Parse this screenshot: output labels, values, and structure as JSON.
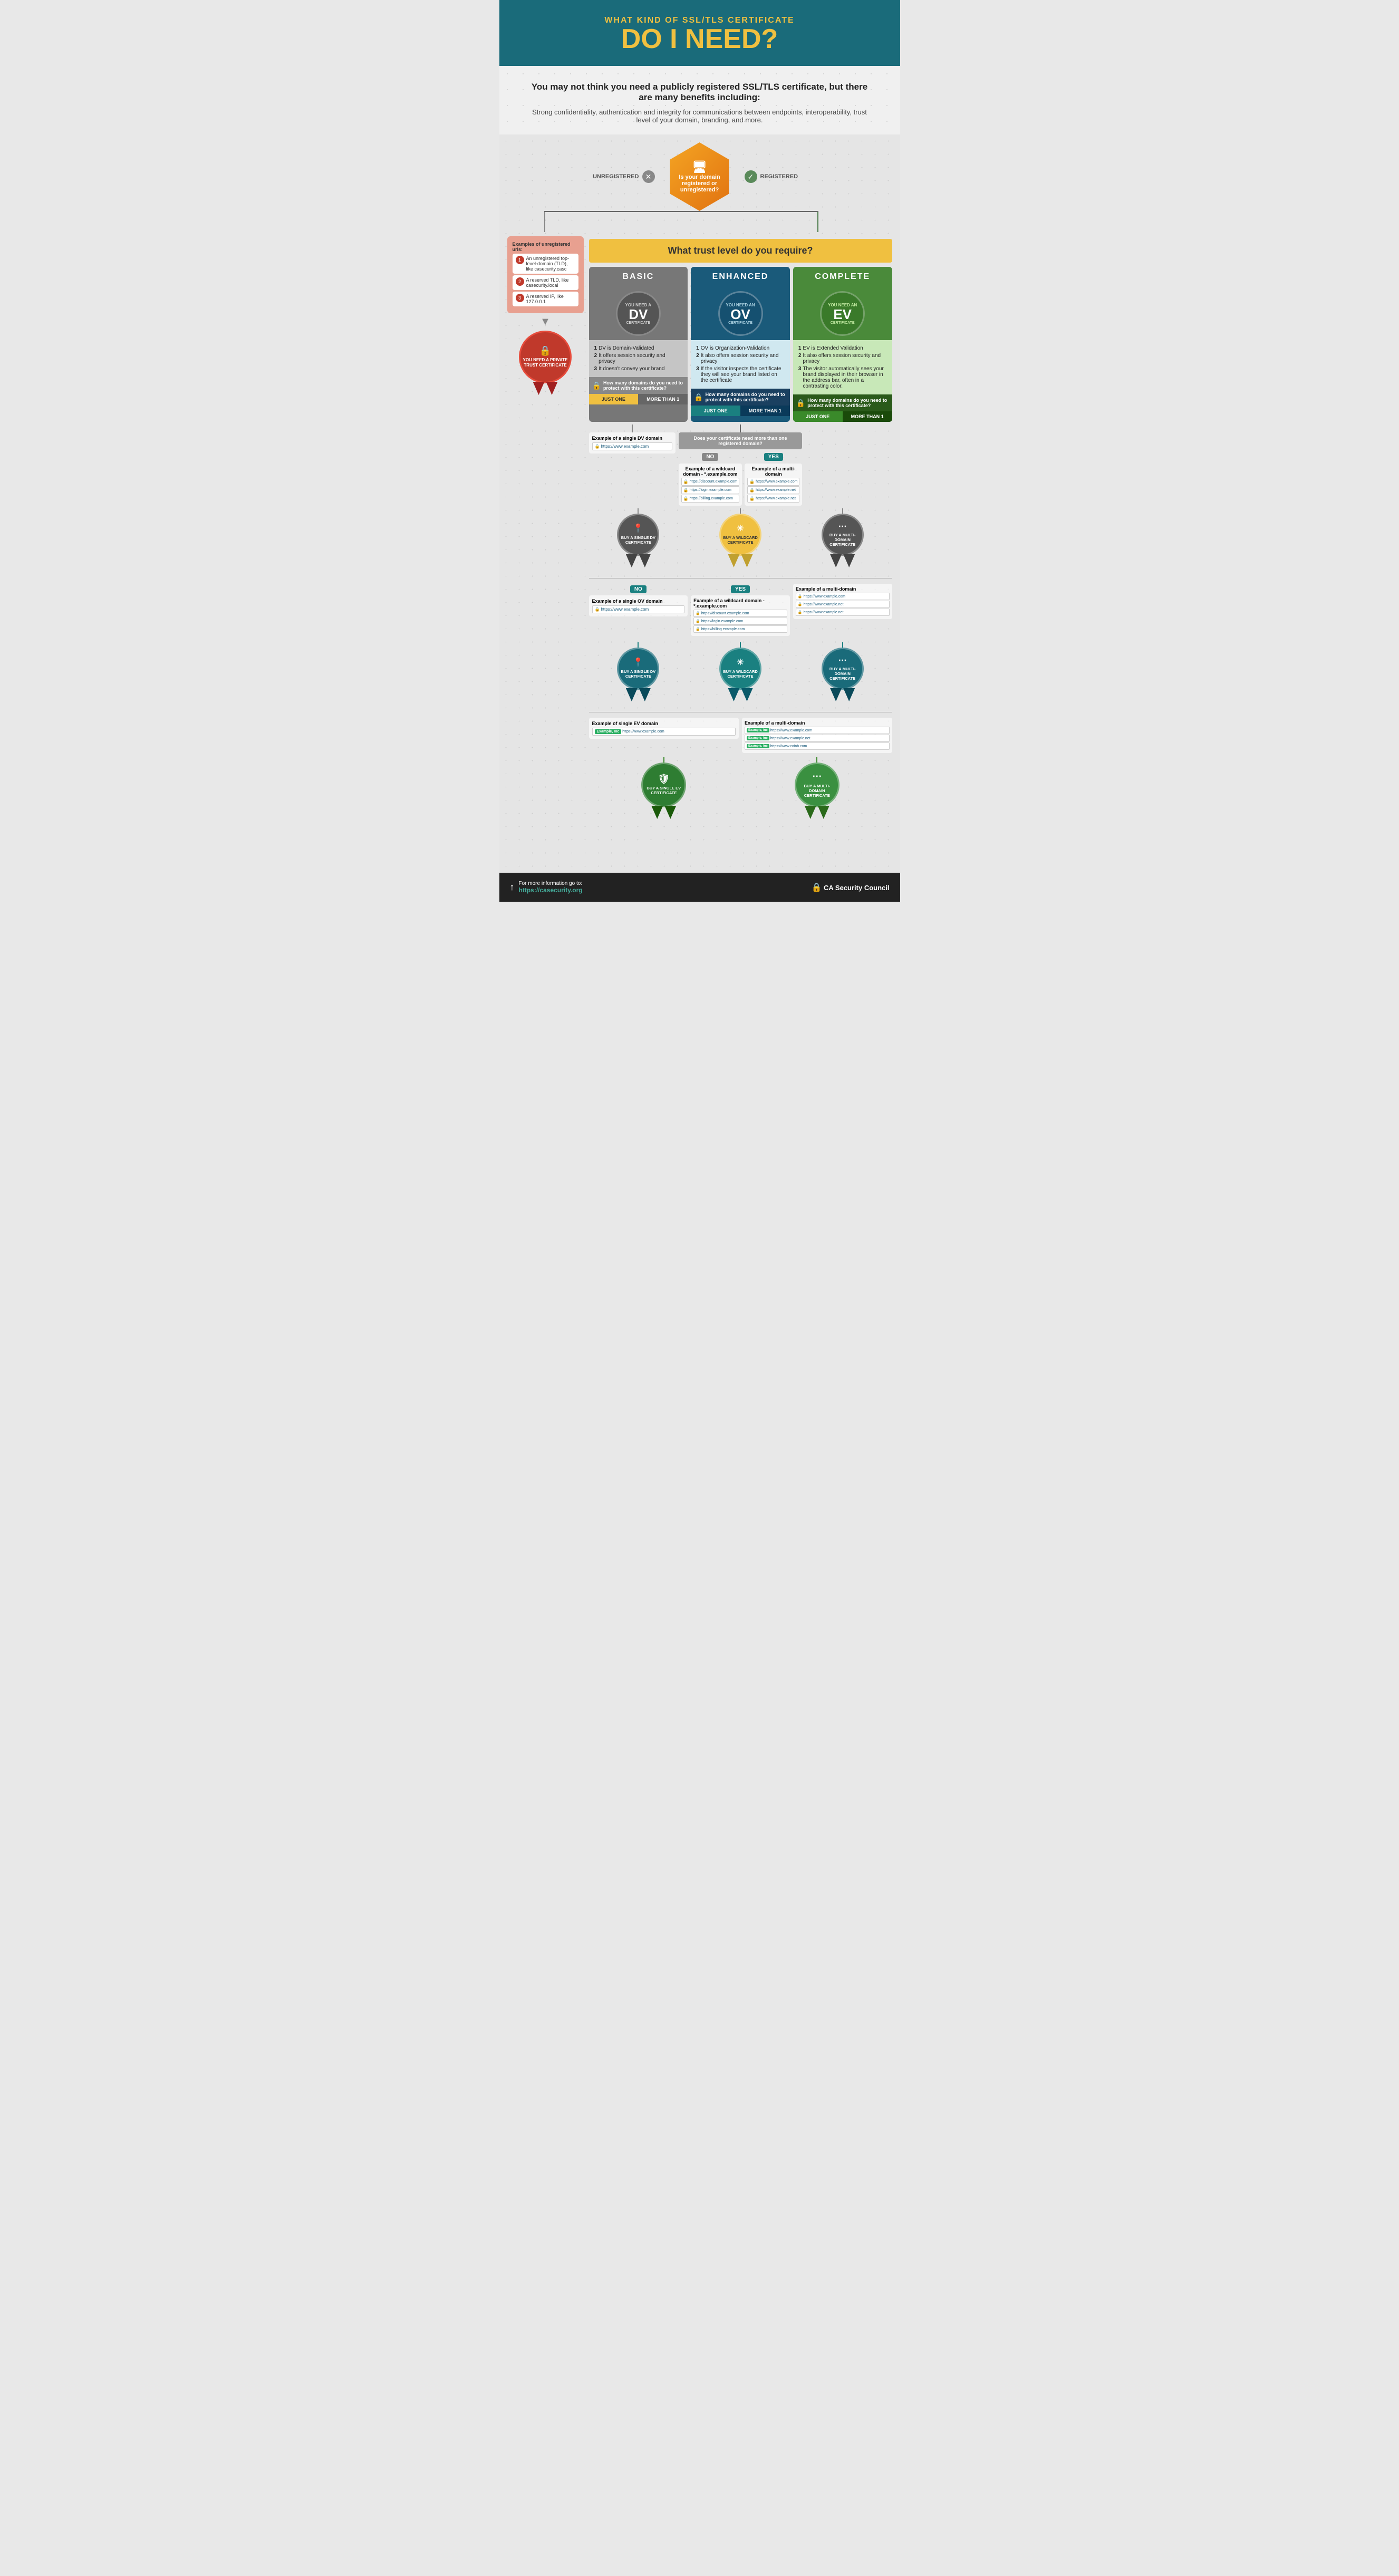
{
  "header": {
    "subtitle": "What kind of SSL/TLS Certificate",
    "title": "Do I Need?",
    "intro_bold": "You may not think you need a publicly registered SSL/TLS certificate, but there are many benefits including:",
    "intro_text": "Strong confidentiality, authentication and integrity for communications between endpoints, interoperability, trust level of your domain, branding, and more."
  },
  "domain_question": {
    "text": "Is your domain registered or unregistered?",
    "unregistered_label": "UNREGISTERED",
    "registered_label": "REGISTERED"
  },
  "unregistered": {
    "title": "Examples of unregistered urls:",
    "examples": [
      {
        "num": "1",
        "text": "An unregistered top-level-domain (TLD), like casecurity.casc"
      },
      {
        "num": "2",
        "text": "A reserved TLD, like casecurity.local"
      },
      {
        "num": "3",
        "text": "A reserved IP, like 127.0.0.1"
      }
    ],
    "result": "YOU NEED A PRIVATE TRUST CERTIFICATE"
  },
  "trust_question": "What trust level do you require?",
  "certificates": {
    "basic": {
      "label": "BASIC",
      "type": "DV",
      "badge_text": "YOU NEED A DV CERTIFICATE",
      "features": [
        "DV is Domain-Validated",
        "It offers session security and privacy",
        "It doesn't convey your brand"
      ],
      "domain_question": "How many domains do you need to protect with this certificate?",
      "just_one": "JUST ONE",
      "more_than_1": "MORE THAN 1",
      "sub_question": "Does your certificate need more than one registered domain?",
      "no_label": "NO",
      "yes_label": "YES"
    },
    "enhanced": {
      "label": "ENHANCED",
      "type": "OV",
      "badge_text": "YOU NEED AN OV CERTIFICATE",
      "features": [
        "OV is Organization-Validation",
        "It also offers session security and privacy",
        "If the visitor inspects the certificate they will see your brand listed on the certificate"
      ],
      "domain_question": "How many domains do you need to protect with this certificate?",
      "just_one": "JUST ONE",
      "more_than_1": "MORE THAN 1",
      "sub_question": "Does your certificate need more than one registered domain?",
      "no_label": "NO",
      "yes_label": "YES"
    },
    "complete": {
      "label": "COMPLETE",
      "type": "EV",
      "badge_text": "YOU NEED AN EV CERTIFICATE",
      "features": [
        "EV is Extended Validation",
        "It also offers session security and privacy",
        "The visitor automatically sees your brand displayed in their browser in the address bar, often in a contrasting color."
      ],
      "domain_question": "How many domains do you need to protect with this certificate?",
      "just_one": "JUST ONE",
      "more_than_1": "MORE THAN 1"
    }
  },
  "outcomes": {
    "buy_single_dv": "BUY A SINGLE DV CERTIFICATE",
    "buy_wildcard": "BUY A WILDCARD CERTIFICATE",
    "buy_multi_domain": "BUY A MULTI-DOMAIN CERTIFICATE",
    "buy_single_ov": "BUY A SINGLE OV CERTIFICATE",
    "buy_wildcard_ov": "BUY A WILDCARD CERTIFICATE",
    "buy_multi_domain_ov": "BUY A MULTI-DOMAIN CERTIFICATE",
    "buy_single_ev": "BUY A SINGLE EV CERTIFICATE",
    "buy_multi_domain_ev": "BUY A MULTI-DOMAIN CERTIFICATE"
  },
  "examples": {
    "single_dv": {
      "title": "Example of a single DV domain",
      "url": "https://www.example.com"
    },
    "wildcard_dv": {
      "title": "Example of a wildcard domain - *.example.com",
      "urls": [
        "https://discount.example.com",
        "https://login.example.com",
        "https://billing.example.com"
      ]
    },
    "multi_dv": {
      "title": "Example of a multi-domain",
      "urls": [
        "https://www.example.com",
        "https://www.example.net",
        "https://www.example.net"
      ]
    },
    "single_ov": {
      "title": "Example of a single OV domain",
      "url": "https://www.example.com"
    },
    "wildcard_ov": {
      "title": "Example of a wildcard domain - *.example.com",
      "urls": [
        "https://discount.example.com",
        "https://login.example.com",
        "https://billing.example.com"
      ]
    },
    "multi_ov": {
      "title": "Example of a multi-domain",
      "urls": [
        "https://www.example.com",
        "https://www.example.net",
        "https://www.example.net"
      ]
    },
    "single_ev": {
      "title": "Example of single EV domain",
      "url": "https://www.example.com"
    },
    "multi_ev": {
      "title": "Example of a multi-domain",
      "urls": [
        "https://www.example.com",
        "https://www.example.net",
        "https://www.coinb.com"
      ]
    }
  },
  "footer": {
    "info_text": "For more information go to:",
    "url": "https://casecurity.org",
    "brand": "CA Security Council"
  }
}
